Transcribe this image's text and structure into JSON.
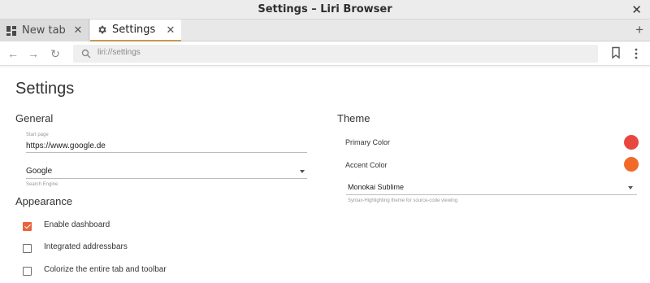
{
  "window": {
    "title": "Settings – Liri Browser",
    "close_glyph": "✕"
  },
  "tabs": [
    {
      "label": "New tab",
      "icon": "dashboard-icon",
      "close_glyph": "✕"
    },
    {
      "label": "Settings",
      "icon": "gear-icon",
      "close_glyph": "✕",
      "active": true
    }
  ],
  "tabstrip": {
    "new_tab_glyph": "+"
  },
  "toolbar": {
    "back_glyph": "←",
    "forward_glyph": "→",
    "reload_glyph": "↻",
    "url": "liri://settings"
  },
  "page": {
    "title": "Settings"
  },
  "general": {
    "title": "General",
    "start_page_caption": "Start page",
    "start_page_value": "https://www.google.de",
    "search_engine_value": "Google",
    "search_engine_caption": "Search Engine"
  },
  "appearance": {
    "title": "Appearance",
    "options": [
      {
        "label": "Enable dashboard",
        "checked": true
      },
      {
        "label": "Integrated addressbars",
        "checked": false
      },
      {
        "label": "Colorize the entire tab and toolbar",
        "checked": false
      }
    ]
  },
  "theme": {
    "title": "Theme",
    "primary_label": "Primary Color",
    "primary_color": "#e8473f",
    "accent_label": "Accent Color",
    "accent_color": "#f26a2a",
    "syntax_value": "Monokai Sublime",
    "syntax_caption": "Syntax-Highlighting theme for source-code viewing"
  },
  "colors": {
    "checkbox_accent": "#e8643c",
    "active_tab_indicator": "#c59a52"
  }
}
